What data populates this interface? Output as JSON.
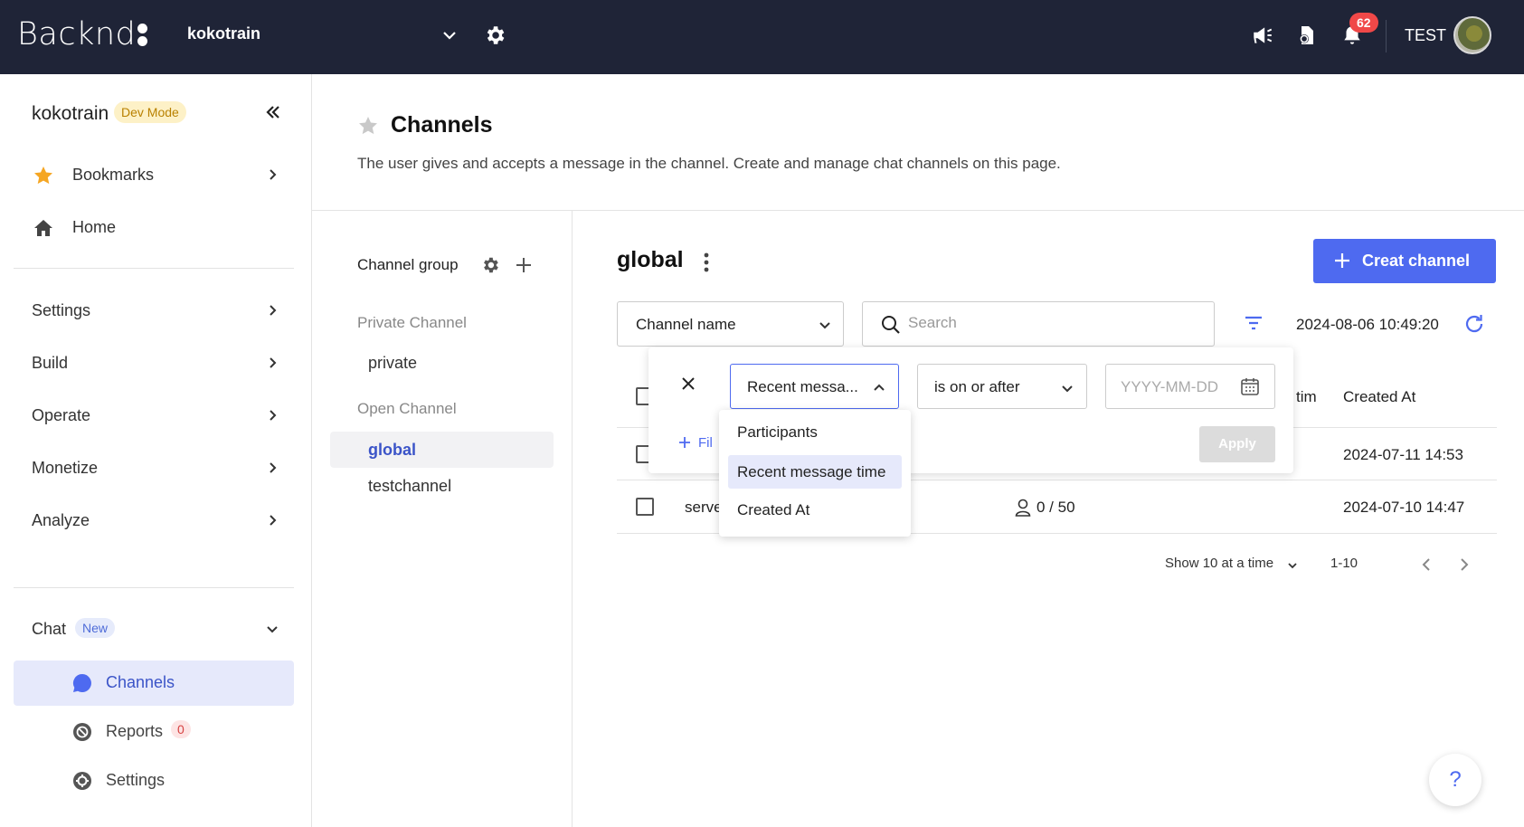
{
  "topbar": {
    "logo": "Backnd",
    "project": "kokotrain",
    "notification_count": "62",
    "user": "TEST"
  },
  "sidebar": {
    "workspace": "kokotrain",
    "mode_badge": "Dev Mode",
    "bookmarks": "Bookmarks",
    "home": "Home",
    "sections": [
      "Settings",
      "Build",
      "Operate",
      "Monetize",
      "Analyze"
    ],
    "chat": "Chat",
    "chat_badge": "New",
    "chat_items": [
      {
        "label": "Channels",
        "icon": "chat-bubble-icon"
      },
      {
        "label": "Reports",
        "icon": "report-icon",
        "badge": "0"
      },
      {
        "label": "Settings",
        "icon": "gear-icon"
      }
    ]
  },
  "header": {
    "title": "Channels",
    "description": "The user gives and accepts a message in the channel. Create and manage chat channels on this page."
  },
  "groups": {
    "title": "Channel group",
    "private_section": "Private Channel",
    "private_items": [
      "private"
    ],
    "open_section": "Open Channel",
    "open_items": [
      "global",
      "testchannel"
    ]
  },
  "main": {
    "title": "global",
    "create_label": "Creat channel",
    "field_select": "Channel name",
    "search_placeholder": "Search",
    "timestamp": "2024-08-06 10:49:20",
    "columns": {
      "recent_partial": "tim",
      "created_at": "Created At"
    },
    "rows": [
      {
        "name": "",
        "participants": "",
        "created": "2024-07-11 14:53"
      },
      {
        "name": "serve",
        "participants": "0 / 50",
        "created": "2024-07-10 14:47"
      }
    ],
    "page_size": "Show 10 at a time",
    "range": "1-10"
  },
  "filter": {
    "field": "Recent messa...",
    "operator": "is on or after",
    "date_placeholder": "YYYY-MM-DD",
    "add_label": "Fil",
    "apply": "Apply",
    "options": [
      "Participants",
      "Recent message time",
      "Created At"
    ],
    "selected_index": 1
  },
  "help": "?",
  "colors": {
    "accent": "#4e6af0",
    "topbar": "#1f2437",
    "badge_red": "#f04848"
  }
}
